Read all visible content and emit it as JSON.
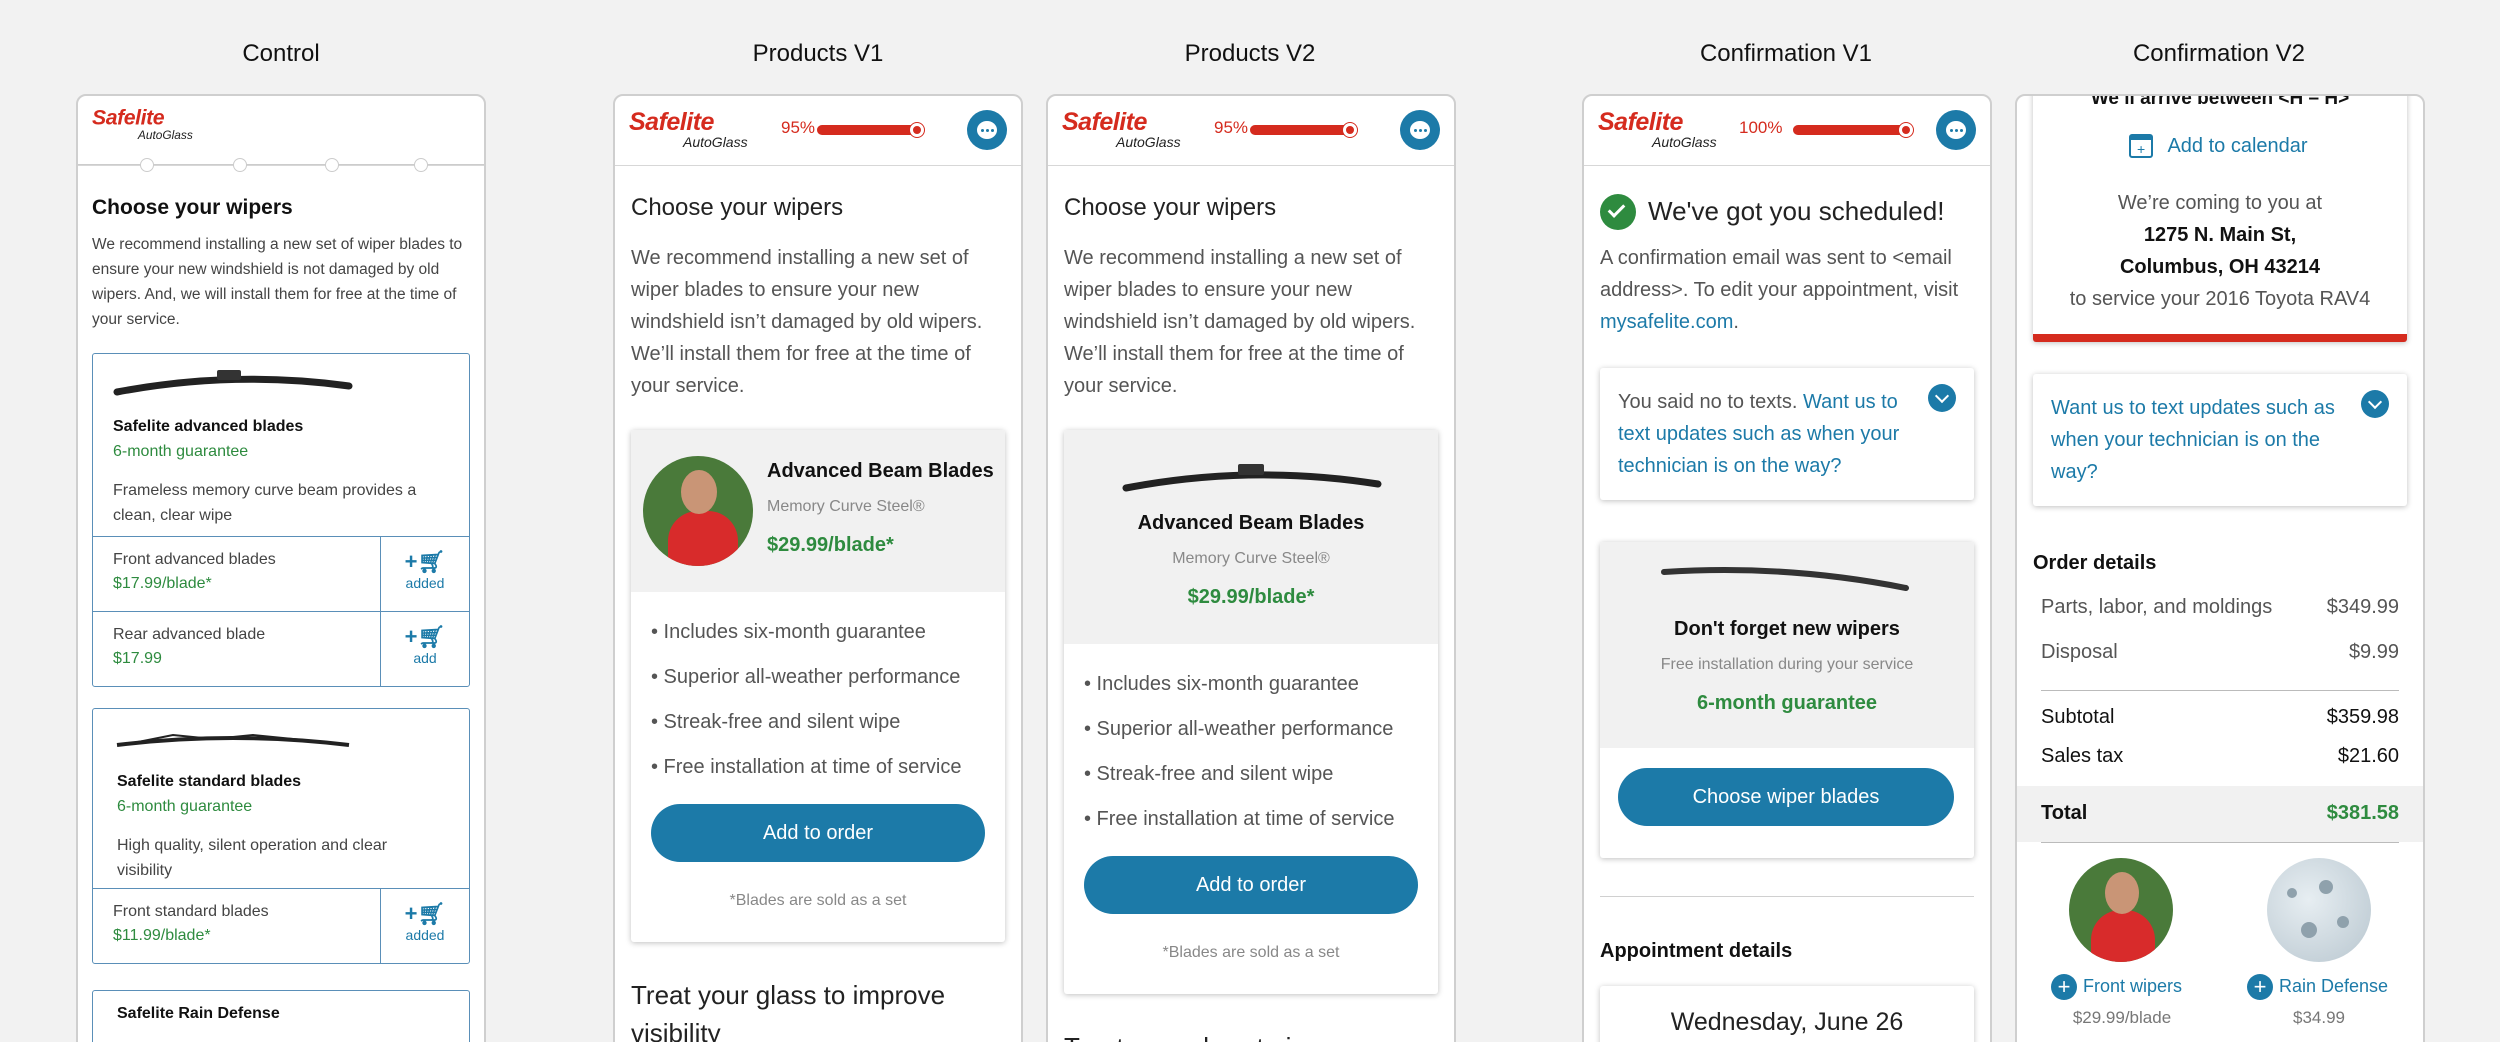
{
  "columns": {
    "control": "Control",
    "products_v1": "Products V1",
    "products_v2": "Products V2",
    "confirmation_v1": "Confirmation V1",
    "confirmation_v2": "Confirmation V2"
  },
  "brand": {
    "name": "Safelite",
    "sub": "AutoGlass",
    "red": "#d52b1e",
    "blue": "#1c7aa8",
    "green": "#2e8b3f"
  },
  "control": {
    "title": "Choose your wipers",
    "intro": "We recommend installing a new set of wiper blades to ensure your new windshield is not damaged by old wipers. And, we will install them for free at the time of your service.",
    "advanced": {
      "name": "Safelite advanced blades",
      "guarantee": "6-month guarantee",
      "desc": "Frameless memory curve beam provides a clean, clear wipe",
      "rows": [
        {
          "label": "Front advanced blades",
          "price": "$17.99/blade*",
          "action": "added"
        },
        {
          "label": "Rear advanced blade",
          "price": "$17.99",
          "action": "add"
        }
      ]
    },
    "standard": {
      "name": "Safelite standard blades",
      "guarantee": "6-month guarantee",
      "desc": "High quality, silent operation and clear visibility",
      "rows": [
        {
          "label": "Front standard blades",
          "price": "$11.99/blade*",
          "action": "added"
        }
      ]
    },
    "rain": {
      "name": "Safelite Rain Defense"
    }
  },
  "products": {
    "progress_label": "95%",
    "progress": 0.95,
    "title": "Choose your wipers",
    "intro": "We recommend installing a new set of wiper blades to ensure your new windshield isn’t damaged by old wipers. We’ll install them for free at the time of your service.",
    "product_name": "Advanced Beam Blades",
    "product_sub": "Memory Curve Steel®",
    "product_price": "$29.99/blade*",
    "bullets": [
      "• Includes six-month guarantee",
      "• Superior all-weather performance",
      "• Streak-free and silent wipe",
      "• Free installation at time of service"
    ],
    "cta": "Add to order",
    "footnote": "*Blades are sold as a set",
    "next_v1": "Treat your glass to improve visibility",
    "next_v2": "Treat your glass to improve"
  },
  "confirmation_v1": {
    "progress_label": "100%",
    "progress": 1.0,
    "title": "We've got you scheduled!",
    "body_prefix": "A confirmation email was sent to <email address>. To edit your appointment, visit ",
    "link": "mysafelite.com",
    "body_suffix": ".",
    "texts_prefix": "You said no to texts. ",
    "texts_link": "Want us to text updates such as when your technician is on the way?",
    "wipers_title": "Don't forget new wipers",
    "wipers_sub": "Free installation during your service",
    "wipers_guarantee": "6-month guarantee",
    "wipers_cta": "Choose wiper blades",
    "appt_heading": "Appointment details",
    "appt_date": "Wednesday, June 26"
  },
  "confirmation_v2": {
    "arrive": "We’ll arrive between <H – H>",
    "calendar": "Add to calendar",
    "coming": "We’re coming to you at",
    "addr1": "1275 N. Main St,",
    "addr2": "Columbus, OH 43214",
    "vehicle": "to service your 2016 Toyota RAV4",
    "texts": "Want us to text updates such as when your technician is on the way?",
    "order_heading": "Order details",
    "lines": [
      {
        "label": "Parts, labor, and moldings",
        "value": "$349.99"
      },
      {
        "label": "Disposal",
        "value": "$9.99"
      }
    ],
    "subtotal_label": "Subtotal",
    "subtotal": "$359.98",
    "tax_label": "Sales tax",
    "tax": "$21.60",
    "total_label": "Total",
    "total": "$381.58",
    "upsells": [
      {
        "label": "Front wipers",
        "price": "$29.99/blade"
      },
      {
        "label": "Rain Defense",
        "price": "$34.99"
      }
    ]
  }
}
